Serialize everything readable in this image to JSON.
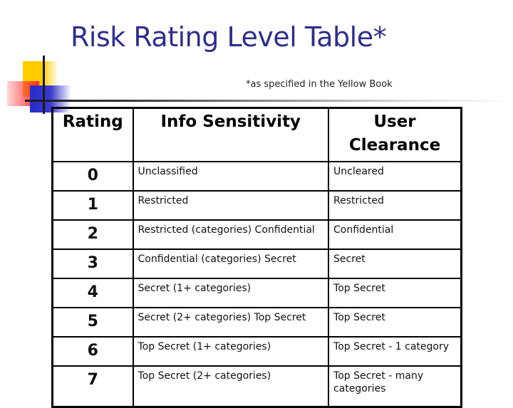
{
  "title": "Risk Rating Level Table*",
  "subtitle": "*as specified in the Yellow Book",
  "table": {
    "headers": [
      "Rating",
      "Info Sensitivity",
      "User Clearance"
    ],
    "rows": [
      {
        "rating": "0",
        "sensitivity": "Unclassified",
        "clearance": "Uncleared"
      },
      {
        "rating": "1",
        "sensitivity": "Restricted",
        "clearance": "Restricted"
      },
      {
        "rating": "2",
        "sensitivity": "Restricted (categories) Confidential",
        "clearance": "Confidential"
      },
      {
        "rating": "3",
        "sensitivity": "Confidential (categories) Secret",
        "clearance": "Secret"
      },
      {
        "rating": "4",
        "sensitivity": "Secret (1+ categories)",
        "clearance": "Top Secret"
      },
      {
        "rating": "5",
        "sensitivity": "Secret (2+ categories) Top Secret",
        "clearance": "Top Secret"
      },
      {
        "rating": "6",
        "sensitivity": "Top Secret (1+ categories)",
        "clearance": "Top Secret - 1 category"
      },
      {
        "rating": "7",
        "sensitivity": "Top Secret (2+ categories)",
        "clearance": "Top Secret - many categories"
      }
    ]
  },
  "colors": {
    "title": "#2e2e8c",
    "accent_yellow": "#ffcc00",
    "accent_red": "#ff2a2a",
    "accent_blue": "#2a2ac8"
  }
}
